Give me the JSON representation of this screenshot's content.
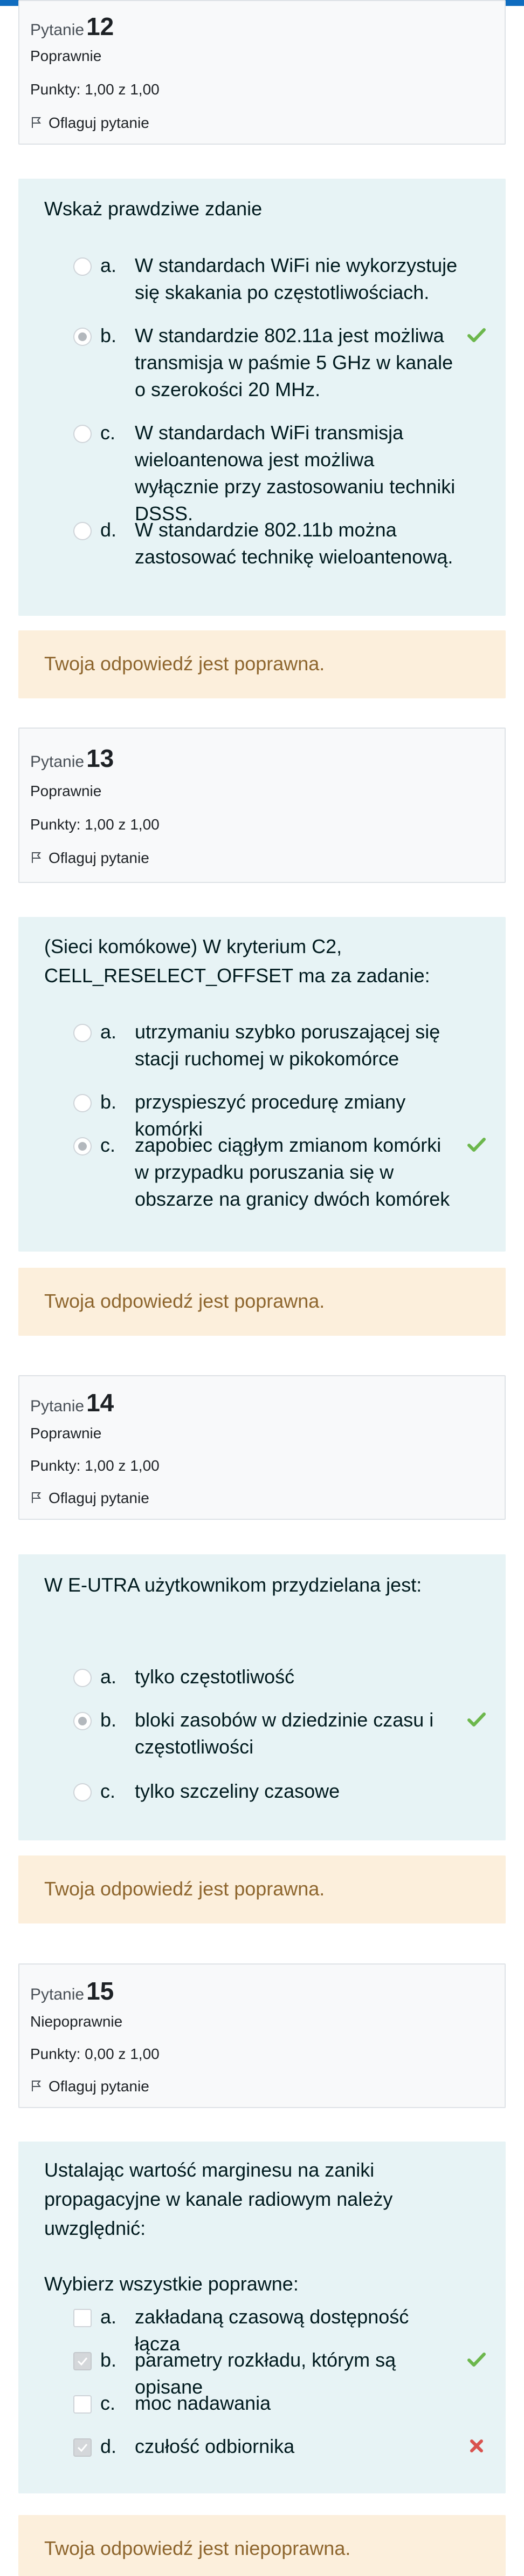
{
  "questions": [
    {
      "label": "Pytanie",
      "number": "12",
      "state": "Poprawnie",
      "grade": "Punkty: 1,00 z 1,00",
      "flag_label": "Oflaguj pytanie",
      "text": "Wskaż prawdziwe zdanie",
      "options": [
        {
          "letter": "a.",
          "text": "W standardach WiFi nie wykorzystuje się skakania po częstotliwościach.",
          "checked": false,
          "mark": ""
        },
        {
          "letter": "b.",
          "text": "W standardzie 802.11a jest możliwa transmisja w paśmie 5 GHz w kanale o szerokości 20 MHz.",
          "checked": true,
          "mark": "correct"
        },
        {
          "letter": "c.",
          "text": "W standardach WiFi transmisja wieloantenowa jest możliwa wyłącznie przy zastosowaniu techniki DSSS.",
          "checked": false,
          "mark": ""
        },
        {
          "letter": "d.",
          "text": "W standardzie 802.11b można zastosować technikę wieloantenową.",
          "checked": false,
          "mark": ""
        }
      ],
      "feedback": "Twoja odpowiedź jest poprawna."
    },
    {
      "label": "Pytanie",
      "number": "13",
      "state": "Poprawnie",
      "grade": "Punkty: 1,00 z 1,00",
      "flag_label": "Oflaguj pytanie",
      "text": "(Sieci komókowe) W kryterium C2, CELL_RESELECT_OFFSET ma za zadanie:",
      "options": [
        {
          "letter": "a.",
          "text": "utrzymaniu szybko poruszającej się stacji ruchomej w pikokomórce",
          "checked": false,
          "mark": ""
        },
        {
          "letter": "b.",
          "text": "przyspieszyć procedurę zmiany komórki",
          "checked": false,
          "mark": ""
        },
        {
          "letter": "c.",
          "text": "zapobiec ciągłym zmianom komórki w przypadku poruszania się w obszarze na granicy dwóch komórek",
          "checked": true,
          "mark": "correct"
        }
      ],
      "feedback": "Twoja odpowiedź jest poprawna."
    },
    {
      "label": "Pytanie",
      "number": "14",
      "state": "Poprawnie",
      "grade": "Punkty: 1,00 z 1,00",
      "flag_label": "Oflaguj pytanie",
      "text": "W E-UTRA użytkownikom przydzielana jest:",
      "options": [
        {
          "letter": "a.",
          "text": "tylko częstotliwość",
          "checked": false,
          "mark": ""
        },
        {
          "letter": "b.",
          "text": "bloki zasobów w dziedzinie czasu i częstotliwości",
          "checked": true,
          "mark": "correct"
        },
        {
          "letter": "c.",
          "text": "tylko szczeliny czasowe",
          "checked": false,
          "mark": ""
        }
      ],
      "feedback": "Twoja odpowiedź jest poprawna."
    },
    {
      "label": "Pytanie",
      "number": "15",
      "state": "Niepoprawnie",
      "grade": "Punkty: 0,00 z 1,00",
      "flag_label": "Oflaguj pytanie",
      "text": "Ustalając wartość marginesu na zaniki propagacyjne w kanale radiowym należy uwzględnić:",
      "prompt": "Wybierz wszystkie poprawne:",
      "options": [
        {
          "letter": "a.",
          "text": "zakładaną czasową dostępność łącza",
          "checked": false,
          "mark": ""
        },
        {
          "letter": "b.",
          "text": "parametry rozkładu, którym są opisane",
          "checked": true,
          "mark": "correct"
        },
        {
          "letter": "c.",
          "text": "moc nadawania",
          "checked": false,
          "mark": ""
        },
        {
          "letter": "d.",
          "text": "czułość odbiornika",
          "checked": true,
          "mark": "incorrect"
        }
      ],
      "feedback": "Twoja odpowiedź jest niepoprawna."
    }
  ],
  "colors": {
    "accent": "#0f6cbf",
    "correct": "#6cb74c",
    "incorrect": "#d9534f",
    "formulation_bg": "#e7f3f5",
    "feedback_bg": "#fcefdc",
    "feedback_text": "#8e662e"
  },
  "icons": {
    "flag": "flag-icon",
    "correct": "check-icon",
    "incorrect": "cross-icon"
  }
}
